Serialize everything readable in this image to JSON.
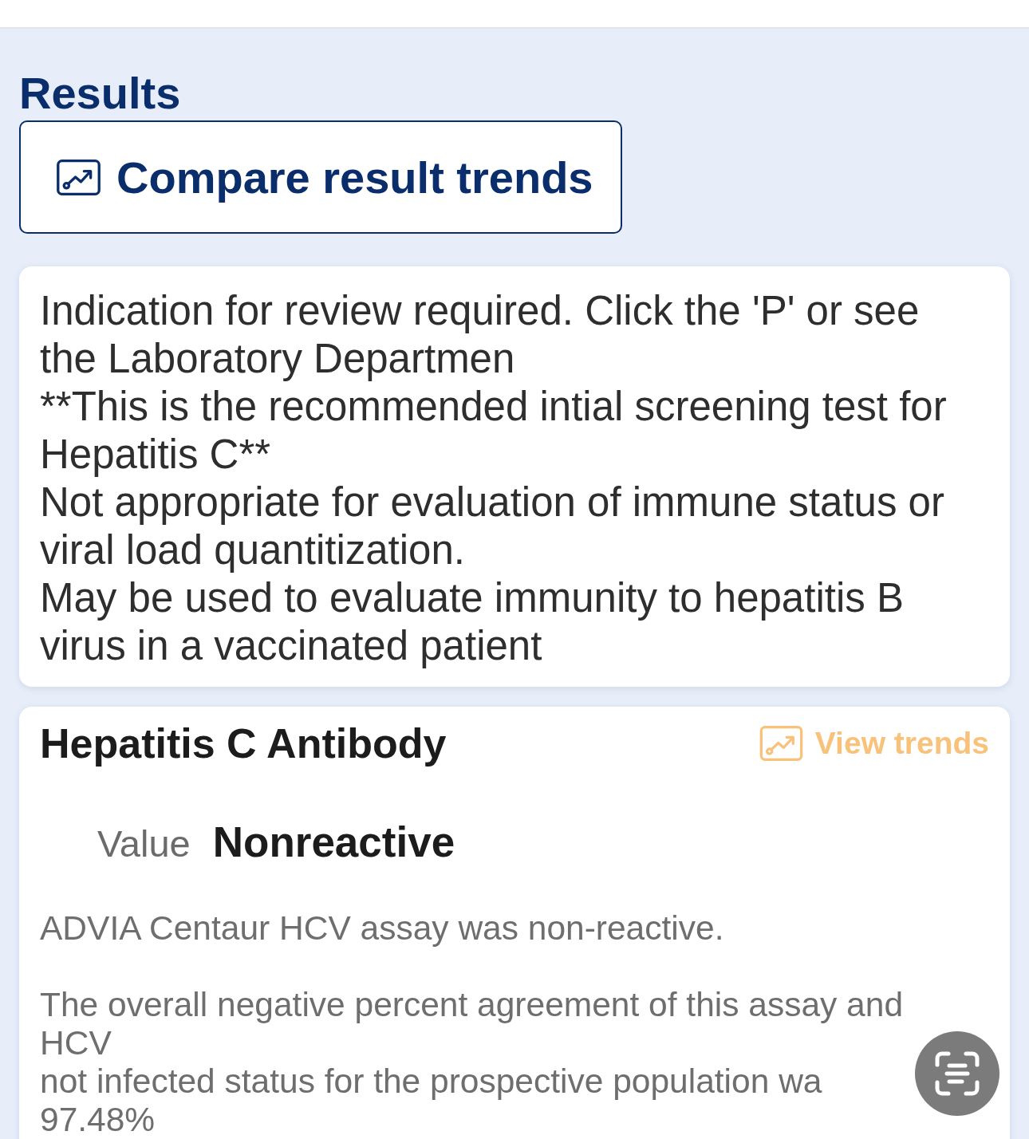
{
  "results": {
    "title": "Results",
    "compare_button": {
      "label": "Compare result trends"
    }
  },
  "notice": {
    "text": "Indication for review required. Click the 'P' or see\nthe Laboratory Departmen\n**This is the recommended intial screening test for\nHepatitis C**\nNot appropriate for evaluation of immune status or\nviral load quantitization.\nMay be used to evaluate immunity to hepatitis B\nvirus in a vaccinated patient"
  },
  "result": {
    "test_name": "Hepatitis C Antibody",
    "trends_link": {
      "label": "View trends"
    },
    "value_label": "Value",
    "value": "Nonreactive",
    "comments": [
      "ADVIA Centaur HCV assay was non-reactive.",
      "The overall negative percent agreement of this assay and\nHCV\nnot infected status for the prospective population wa\n97.48%"
    ]
  }
}
